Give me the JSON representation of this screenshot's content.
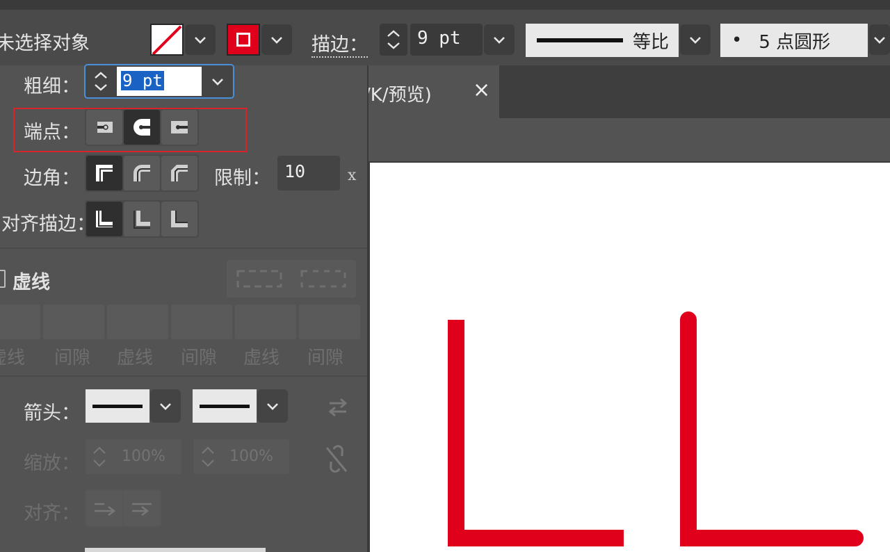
{
  "topbar": {
    "selection_label": "未选择对象",
    "stroke_label": "描边：",
    "stroke_weight": "9 pt",
    "profile_label": "等比",
    "brush_dot": "•",
    "brush_label": "5 点圆形"
  },
  "panel": {
    "weight_label": "粗细：",
    "weight_value": "9 pt",
    "cap_label": "端点：",
    "corner_label": "边角：",
    "limit_label": "限制：",
    "limit_value": "10",
    "limit_unit": "x",
    "align_label": "对齐描边：",
    "dashed_label": "虚线",
    "dash_labels": [
      "虚线",
      "间隙",
      "虚线",
      "间隙",
      "虚线",
      "间隙"
    ],
    "arrow_label": "箭头：",
    "scale_label": "缩放：",
    "scale_start": "100%",
    "scale_end": "100%",
    "align_arrow_label": "对齐："
  },
  "document": {
    "tab_title": "/K/预览)",
    "close_glyph": "×"
  },
  "colors": {
    "stroke": "#e0001b",
    "panel_bg": "#535353",
    "highlight_box": "#d9232a",
    "focus_ring": "#4a8fd9"
  },
  "icons": [
    "chevron-down-icon",
    "spinner-icon",
    "butt-cap-icon",
    "round-cap-icon",
    "projecting-cap-icon",
    "miter-join-icon",
    "round-join-icon",
    "bevel-join-icon",
    "align-center-icon",
    "align-inside-icon",
    "align-outside-icon",
    "swap-arrows-icon",
    "link-icon"
  ]
}
